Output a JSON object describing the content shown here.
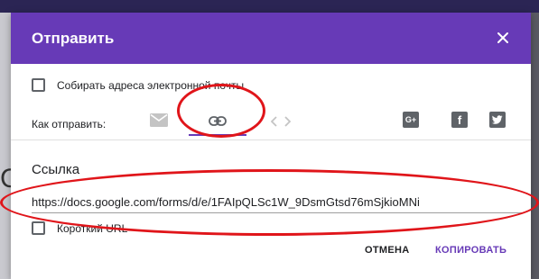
{
  "dialog": {
    "title": "Отправить",
    "close_icon": "close-icon"
  },
  "collect_emails": {
    "label": "Собирать адреса электронной почты",
    "checked": false
  },
  "send_via": {
    "label": "Как отправить:",
    "options": [
      {
        "icon": "email-icon",
        "selected": false
      },
      {
        "icon": "link-icon",
        "selected": true
      },
      {
        "icon": "embed-code-icon",
        "selected": false
      }
    ],
    "social": [
      {
        "icon": "google-plus-icon",
        "glyph": "G+"
      },
      {
        "icon": "facebook-icon",
        "glyph": "f"
      },
      {
        "icon": "twitter-icon"
      }
    ]
  },
  "link": {
    "heading": "Ссылка",
    "url": "https://docs.google.com/forms/d/e/1FAIpQLSc1W_9DsmGtsd76mSjkioMNi"
  },
  "shorten": {
    "label": "Короткий URL",
    "checked": false
  },
  "actions": {
    "cancel": "ОТМЕНА",
    "copy": "КОПИРОВАТЬ"
  },
  "background": {
    "partial_text": "С"
  },
  "colors": {
    "accent": "#673ab7",
    "annotation": "#e0151a"
  }
}
